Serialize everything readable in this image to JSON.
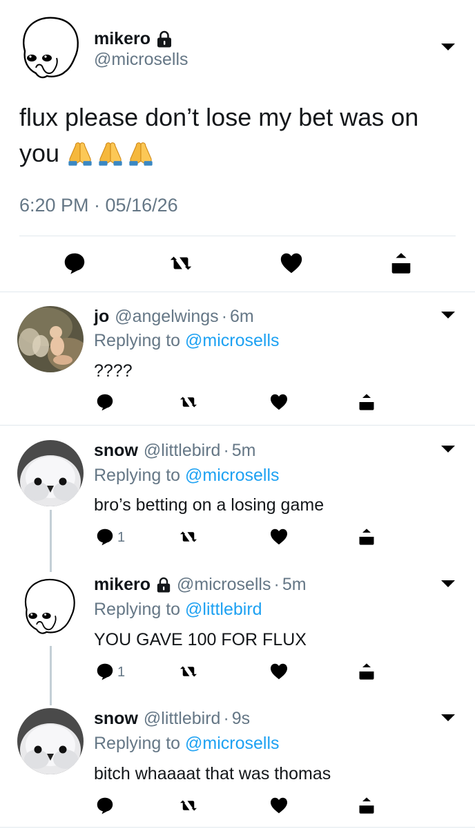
{
  "main_tweet": {
    "name": "mikero",
    "handle": "@microsells",
    "text": "flux please don’t lose my bet was on you 🙏🙏🙏",
    "text_line1": "flux please don’t lose my bet was on",
    "text_line2": "you",
    "emoji": "praying-hands-emoji",
    "time": "6:20 PM · 05/16/26",
    "locked": true
  },
  "replies": [
    {
      "name": "jo",
      "handle": "@angelwings",
      "sep": "·",
      "time": "6m",
      "replying_prefix": "Replying to",
      "replying_to": "@microsells",
      "text": "????",
      "reply_count": "",
      "avatar": "fairy-painting-avatar",
      "locked": false
    },
    {
      "name": "snow",
      "handle": "@littlebird",
      "sep": "·",
      "time": "5m",
      "replying_prefix": "Replying to",
      "replying_to": "@microsells",
      "text": "bro’s betting on a losing game",
      "reply_count": "1",
      "avatar": "white-chick-avatar",
      "locked": false
    },
    {
      "name": "mikero",
      "handle": "@microsells",
      "sep": "·",
      "time": "5m",
      "replying_prefix": "Replying to",
      "replying_to": "@littlebird",
      "text": "YOU GAVE 100 FOR FLUX",
      "reply_count": "1",
      "avatar": "sketch-face-avatar",
      "locked": true
    },
    {
      "name": "snow",
      "handle": "@littlebird",
      "sep": "·",
      "time": "9s",
      "replying_prefix": "Replying to",
      "replying_to": "@microsells",
      "text": "bitch whaaaat that was thomas",
      "reply_count": "",
      "avatar": "white-chick-avatar",
      "locked": false
    }
  ],
  "icons": {
    "reply": "reply-icon",
    "retweet": "retweet-icon",
    "like": "like-icon",
    "share": "share-icon",
    "more": "chevron-down-icon",
    "lock": "lock-icon"
  },
  "colors": {
    "link": "#1da1f2",
    "secondary_text": "#657786",
    "icon": "#657786",
    "divider": "#e1e8ed",
    "thread_line": "#c4cfd6"
  }
}
